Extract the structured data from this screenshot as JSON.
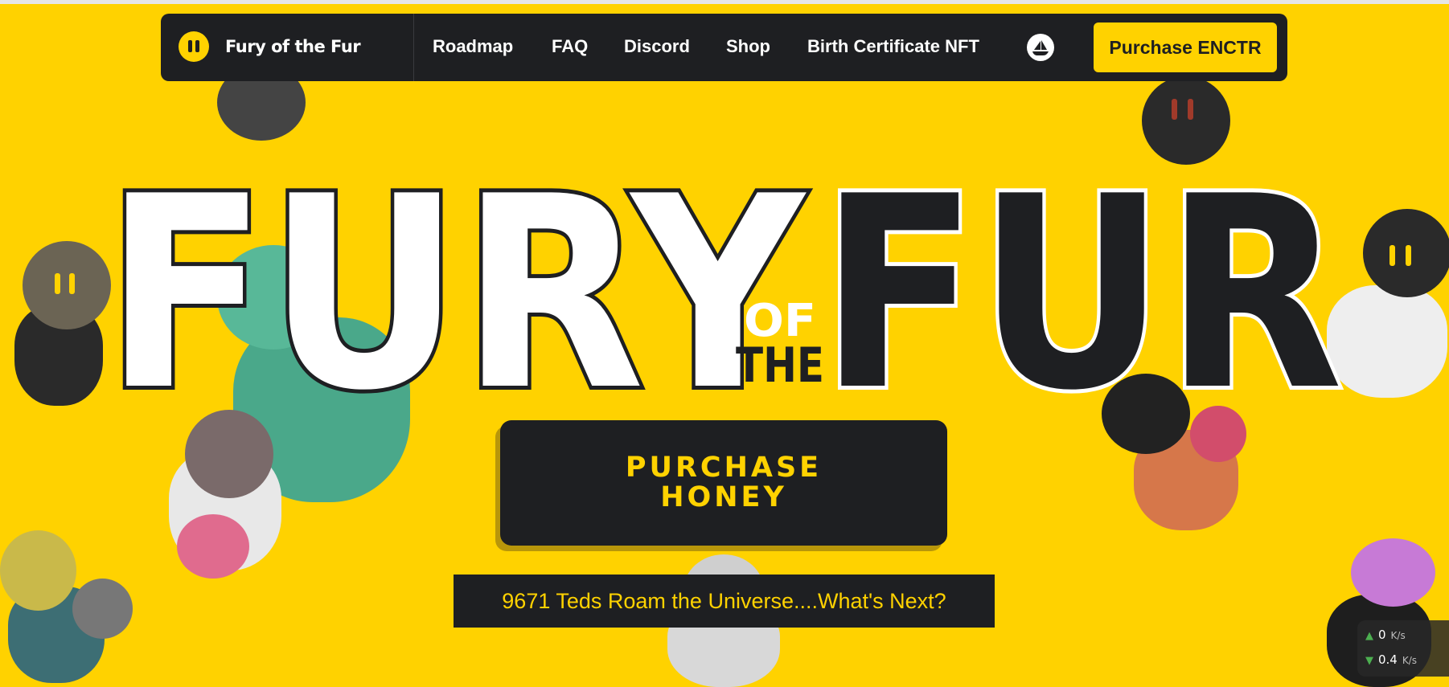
{
  "brand": {
    "name": "Fury of the Fur"
  },
  "nav": {
    "items": [
      {
        "label": "Roadmap"
      },
      {
        "label": "FAQ"
      },
      {
        "label": "Discord"
      },
      {
        "label": "Shop"
      },
      {
        "label": "Birth Certificate NFT"
      }
    ],
    "opensea_icon": "opensea-boat-icon",
    "cta_label": "Purchase ENCTR"
  },
  "hero": {
    "title_word_1": "FURY",
    "title_of": "OF",
    "title_the": "THE",
    "title_word_2": "FUR",
    "button_line_1": "PURCHASE",
    "button_line_2": "HONEY",
    "tagline": "9671 Teds Roam the Universe....What's Next?"
  },
  "speed_widget": {
    "upload_value": "0",
    "upload_unit": "K/s",
    "download_value": "0.4",
    "download_unit": "K/s"
  },
  "colors": {
    "background": "#FFD200",
    "navbar": "#1e1f22",
    "accent": "#FFD200",
    "title_light": "#ffffff",
    "title_dark": "#1e1f22"
  }
}
